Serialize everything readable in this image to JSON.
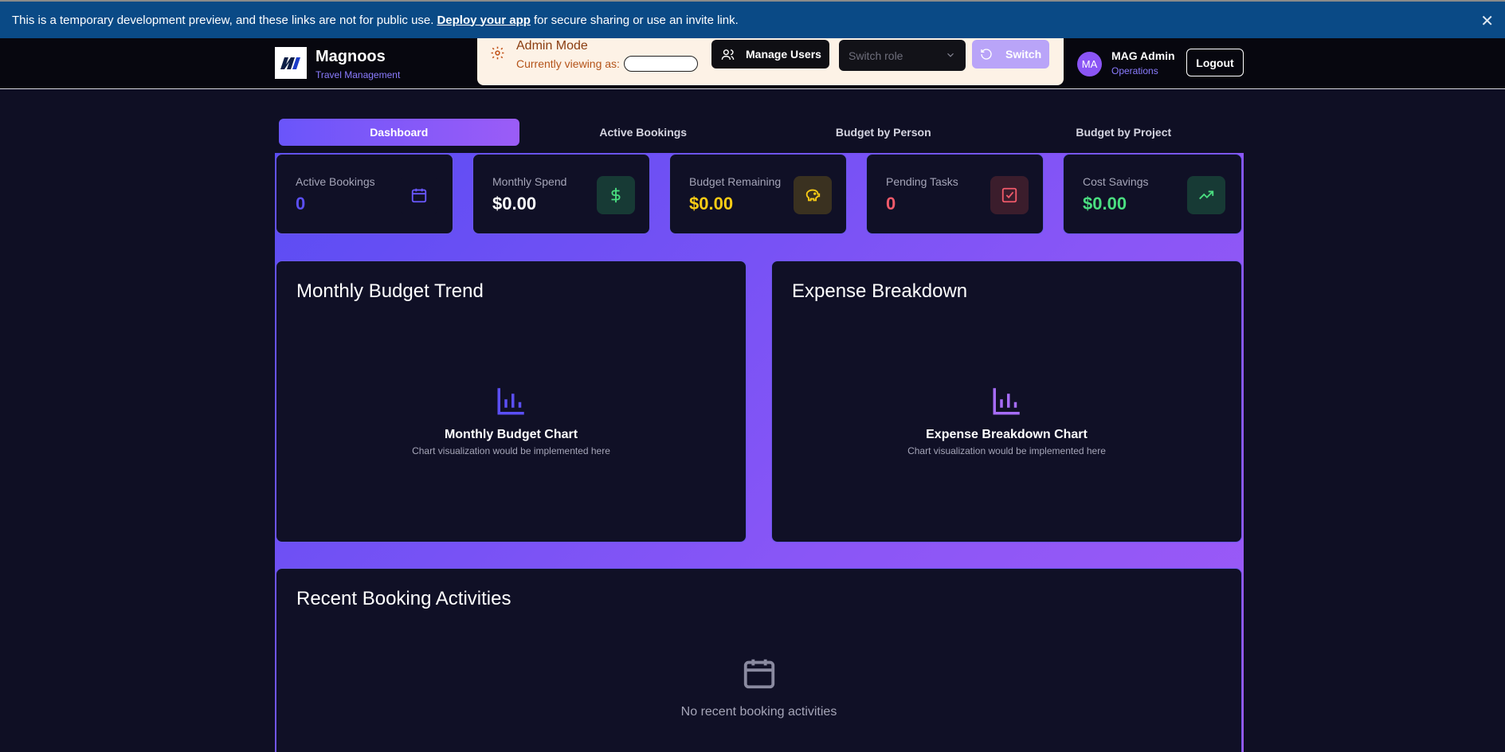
{
  "banner": {
    "text_before": "This is a temporary development preview, and these links are not for public use.",
    "link": "Deploy your app",
    "text_after": "for secure sharing or use an invite link.",
    "close": "✕"
  },
  "brand": {
    "name": "Magnoos",
    "subtitle": "Travel Management"
  },
  "admin": {
    "title": "Admin Mode",
    "viewing_label": "Currently viewing as:",
    "manage_users": "Manage Users",
    "switch_role_placeholder": "Switch role",
    "switch_button": "Switch"
  },
  "user": {
    "initials": "MA",
    "name": "MAG Admin",
    "role": "Operations",
    "logout": "Logout"
  },
  "tabs": [
    "Dashboard",
    "Active Bookings",
    "Budget by Person",
    "Budget by Project"
  ],
  "stats": [
    {
      "label": "Active Bookings",
      "value": "0",
      "value_color": "#5b4ff5",
      "icon": "calendar-icon",
      "icon_bg": "#101026",
      "icon_color": "#6a58ff"
    },
    {
      "label": "Monthly Spend",
      "value": "$0.00",
      "value_color": "#ffffff",
      "icon": "dollar-icon",
      "icon_bg": "#173a35",
      "icon_color": "#4ade80"
    },
    {
      "label": "Budget Remaining",
      "value": "$0.00",
      "value_color": "#facc15",
      "icon": "piggy-bank-icon",
      "icon_bg": "#3a3120",
      "icon_color": "#facc15"
    },
    {
      "label": "Pending Tasks",
      "value": "0",
      "value_color": "#f05a6a",
      "icon": "check-square-icon",
      "icon_bg": "#3b1d2c",
      "icon_color": "#f05a6a"
    },
    {
      "label": "Cost Savings",
      "value": "$0.00",
      "value_color": "#4ade80",
      "icon": "trending-up-icon",
      "icon_bg": "#173a35",
      "icon_color": "#4ade80"
    }
  ],
  "panels": {
    "budget": {
      "title": "Monthly Budget Trend",
      "chart_title": "Monthly Budget Chart",
      "chart_sub": "Chart visualization would be implemented here",
      "icon_color": "#5b4ff5"
    },
    "expense": {
      "title": "Expense Breakdown",
      "chart_title": "Expense Breakdown Chart",
      "chart_sub": "Chart visualization would be implemented here",
      "icon_color": "#a66cf7"
    }
  },
  "recent": {
    "title": "Recent Booking Activities",
    "empty": "No recent booking activities"
  }
}
